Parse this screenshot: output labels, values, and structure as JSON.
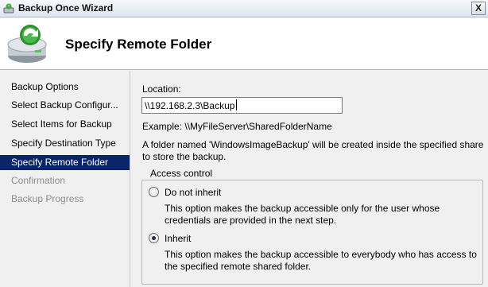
{
  "window": {
    "title": "Backup Once Wizard",
    "close_glyph": "X",
    "app_icon": "backup-app-icon"
  },
  "header": {
    "title": "Specify Remote Folder",
    "icon": "backup-drive-icon"
  },
  "sidebar": {
    "items": [
      {
        "label": "Backup Options",
        "state": "normal"
      },
      {
        "label": "Select Backup Configur...",
        "state": "normal"
      },
      {
        "label": "Select Items for Backup",
        "state": "normal"
      },
      {
        "label": "Specify Destination Type",
        "state": "normal"
      },
      {
        "label": "Specify Remote Folder",
        "state": "active"
      },
      {
        "label": "Confirmation",
        "state": "disabled"
      },
      {
        "label": "Backup Progress",
        "state": "disabled"
      }
    ]
  },
  "main": {
    "location_label": "Location:",
    "location_value": "\\\\192.168.2.3\\Backup",
    "example_text": "Example: \\\\MyFileServer\\SharedFolderName",
    "info_line1": "A folder named 'WindowsImageBackup' will be created inside the specified share",
    "info_line2": "to store the backup.",
    "access_control": {
      "legend": "Access control",
      "options": [
        {
          "label": "Do not inherit",
          "selected": false,
          "desc1": "This option makes the backup accessible only for the user whose",
          "desc2": "credentials are provided in the next step."
        },
        {
          "label": "Inherit",
          "selected": true,
          "desc1": "This option makes the backup accessible to everybody who has access to",
          "desc2": "the specified remote shared folder."
        }
      ]
    }
  },
  "colors": {
    "active_nav_bg": "#0a246a",
    "disabled_text": "#8d8d8d"
  }
}
